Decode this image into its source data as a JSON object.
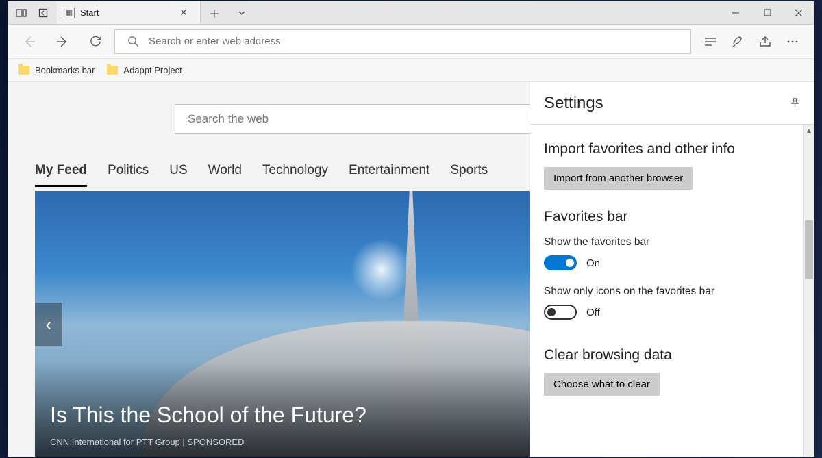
{
  "tab": {
    "title": "Start"
  },
  "address_bar": {
    "placeholder": "Search or enter web address"
  },
  "bookmarks_bar": {
    "items": [
      {
        "label": "Bookmarks bar"
      },
      {
        "label": "Adappt Project"
      }
    ]
  },
  "start_page": {
    "search_placeholder": "Search the web",
    "feed_tabs": [
      "My Feed",
      "Politics",
      "US",
      "World",
      "Technology",
      "Entertainment",
      "Sports"
    ],
    "active_tab": "My Feed",
    "hero": {
      "headline": "Is This the School of the Future?",
      "source": "CNN International for PTT Group | SPONSORED"
    }
  },
  "settings_panel": {
    "title": "Settings",
    "import_heading": "Import favorites and other info",
    "import_button": "Import from another browser",
    "favorites_heading": "Favorites bar",
    "show_favorites_label": "Show the favorites bar",
    "show_favorites_state": "On",
    "icons_only_label": "Show only icons on the favorites bar",
    "icons_only_state": "Off",
    "clear_heading": "Clear browsing data",
    "clear_button": "Choose what to clear"
  }
}
